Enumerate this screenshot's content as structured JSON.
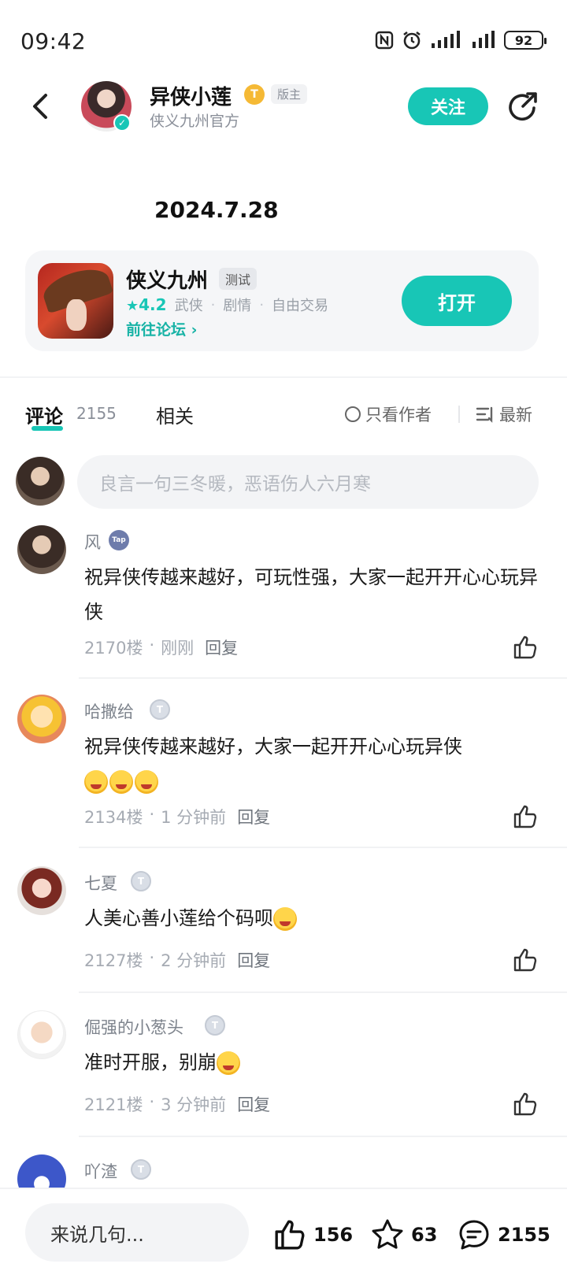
{
  "status_bar": {
    "time": "09:42",
    "battery": "92"
  },
  "header": {
    "username": "异侠小莲",
    "level_badge": "T",
    "role": "版主",
    "subtitle": "侠义九州官方",
    "follow_label": "关注"
  },
  "post": {
    "title": "2024.7.28"
  },
  "game_card": {
    "name": "侠义九州",
    "tag": "测试",
    "rating": "4.2",
    "genres": [
      "武侠",
      "剧情",
      "自由交易"
    ],
    "forum_link": "前往论坛",
    "open_label": "打开"
  },
  "tabs": {
    "comments_label": "评论",
    "comments_count": "2155",
    "related_label": "相关",
    "author_only_label": "只看作者",
    "sort_label": "最新"
  },
  "comment_input": {
    "placeholder": "良言一句三冬暖，恶语伤人六月寒"
  },
  "comments": [
    {
      "name": "风",
      "badge": "Tap",
      "text": "祝异侠传越来越好，可玩性强，大家一起开开心心玩异侠",
      "floor": "2170楼",
      "time": "刚刚",
      "reply": "回复"
    },
    {
      "name": "哈撒给",
      "badge": "T",
      "text": "祝异侠传越来越好，大家一起开开心心玩异侠",
      "floor": "2134楼",
      "time": "1 分钟前",
      "reply": "回复"
    },
    {
      "name": "七夏",
      "badge": "T",
      "text": "人美心善小莲给个码呗",
      "floor": "2127楼",
      "time": "2 分钟前",
      "reply": "回复"
    },
    {
      "name": "倔强的小葱头",
      "badge": "T",
      "text": "准时开服，别崩",
      "floor": "2121楼",
      "time": "3 分钟前",
      "reply": "回复"
    },
    {
      "name": "吖渣",
      "badge": "T"
    }
  ],
  "bottom_bar": {
    "input_placeholder": "来说几句...",
    "likes": "156",
    "favorites": "63",
    "comments": "2155"
  },
  "colors": {
    "accent": "#18c6b6",
    "text": "#1a1a1a",
    "muted": "#a6abb3"
  }
}
